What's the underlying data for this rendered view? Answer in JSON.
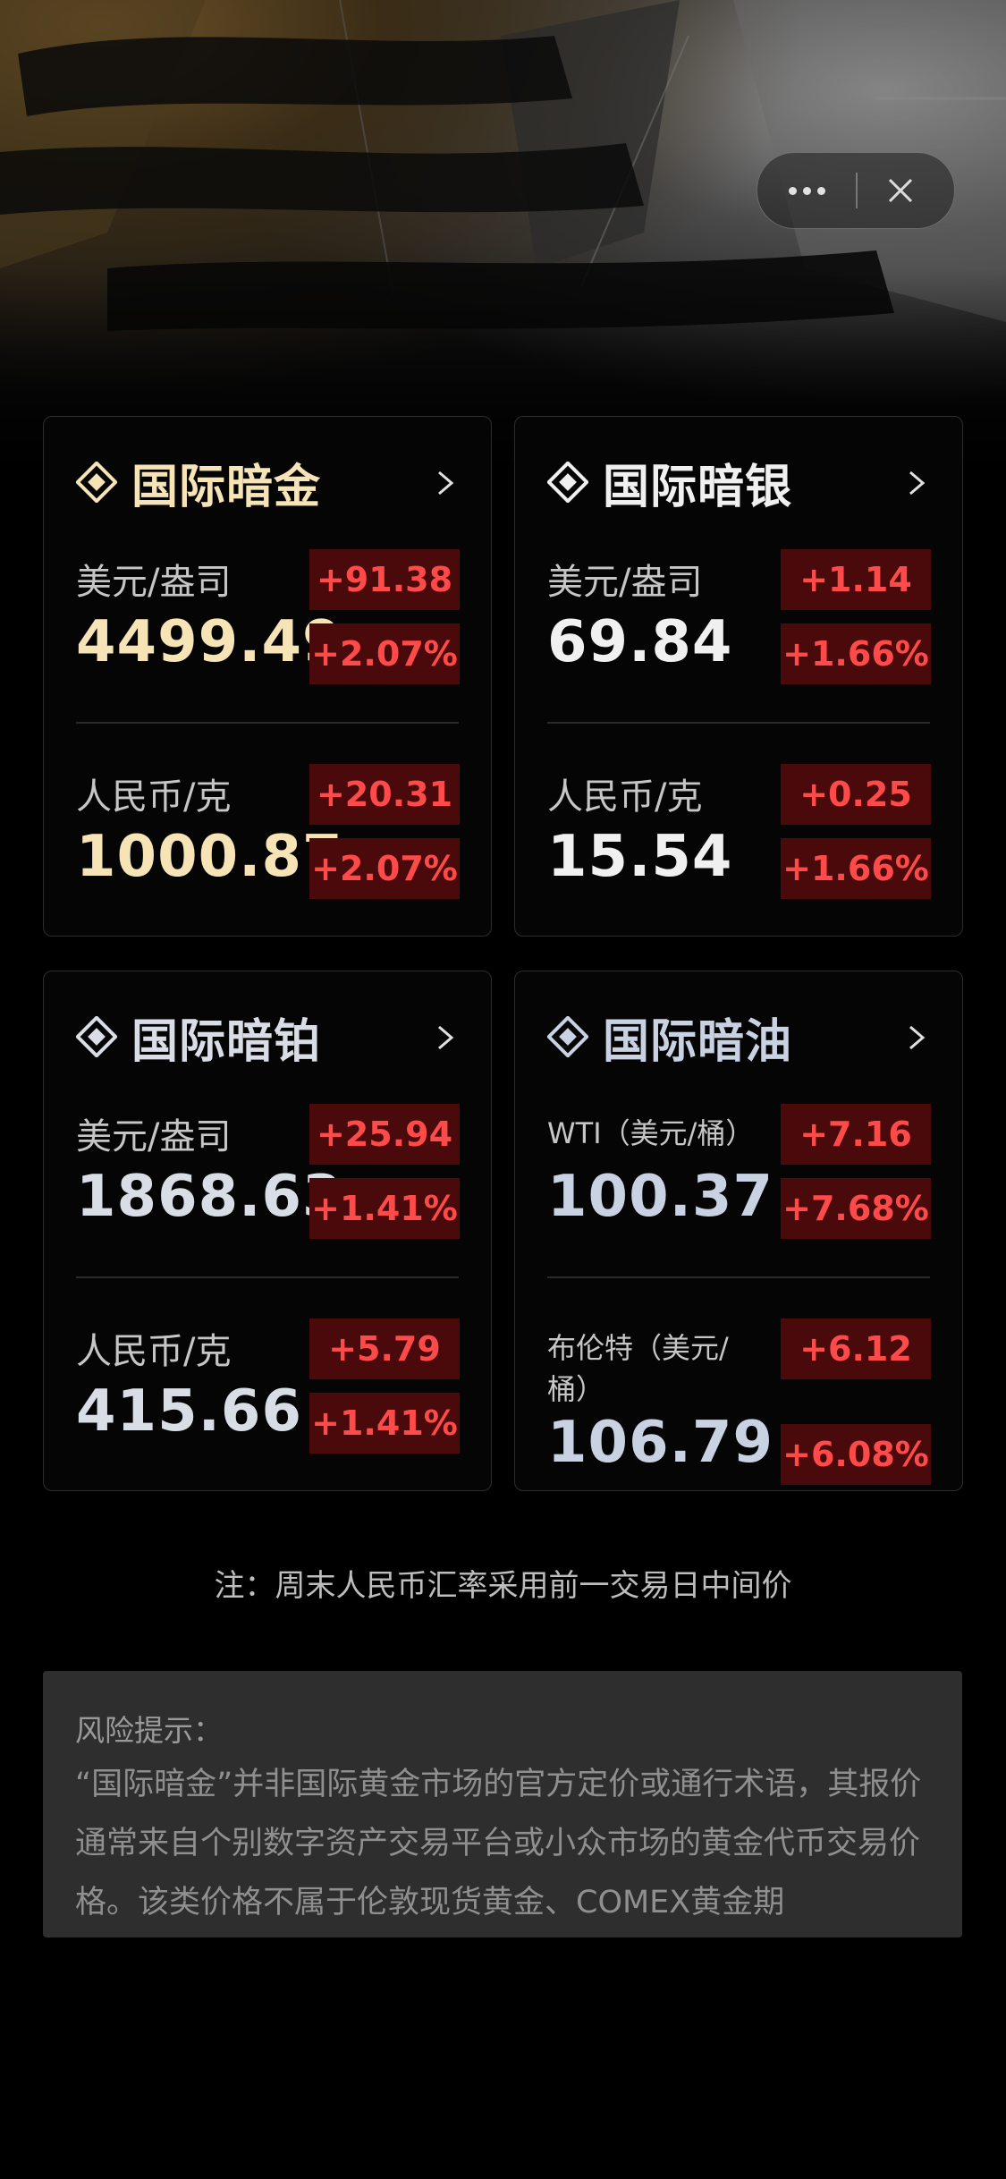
{
  "header": {
    "more_icon": "more-dots-icon",
    "close_icon": "close-icon"
  },
  "cards": {
    "gold": {
      "title": "国际暗金",
      "usd": {
        "label": "美元/盎司",
        "price": "4499.49",
        "change": "+91.38",
        "percent": "+2.07%"
      },
      "cny": {
        "label": "人民币/克",
        "price": "1000.87",
        "change": "+20.31",
        "percent": "+2.07%"
      }
    },
    "silver": {
      "title": "国际暗银",
      "usd": {
        "label": "美元/盎司",
        "price": "69.84",
        "change": "+1.14",
        "percent": "+1.66%"
      },
      "cny": {
        "label": "人民币/克",
        "price": "15.54",
        "change": "+0.25",
        "percent": "+1.66%"
      }
    },
    "platinum": {
      "title": "国际暗铂",
      "usd": {
        "label": "美元/盎司",
        "price": "1868.63",
        "change": "+25.94",
        "percent": "+1.41%"
      },
      "cny": {
        "label": "人民币/克",
        "price": "415.66",
        "change": "+5.79",
        "percent": "+1.41%"
      }
    },
    "oil": {
      "title": "国际暗油",
      "wti": {
        "label": "WTI（美元/桶）",
        "price": "100.37",
        "change": "+7.16",
        "percent": "+7.68%"
      },
      "brent": {
        "label": "布伦特（美元/桶）",
        "price": "106.79",
        "change": "+6.12",
        "percent": "+6.08%"
      }
    }
  },
  "note": "注：周末人民币汇率采用前一交易日中间价",
  "risk": {
    "title": "风险提示：",
    "body": "“国际暗金”并非国际黄金市场的官方定价或通行术语，其报价通常来自个别数字资产交易平台或小众市场的黄金代币交易价格。该类价格不属于伦敦现货黄金、COMEX黄金期"
  },
  "colors": {
    "background": "#000000",
    "badge_bg": "#4a0a0c",
    "badge_text": "#ff4a4a",
    "gold_text": "#f6e3b6"
  }
}
